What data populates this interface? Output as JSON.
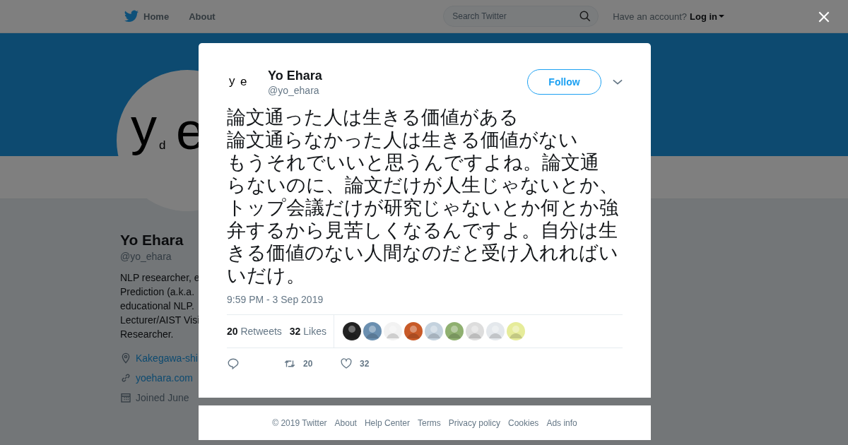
{
  "topbar": {
    "nav": [
      {
        "label": "Home",
        "kind": "home"
      },
      {
        "label": "About",
        "kind": "plain"
      }
    ],
    "search": {
      "placeholder": "Search Twitter"
    },
    "account_prompt": "Have an account?",
    "login": "Log in"
  },
  "profile": {
    "avatar_text": [
      "y",
      "d",
      "e"
    ],
    "name": "Yo Ehara",
    "handle": "@yo_ehara",
    "bio_lines": [
      "NLP researcher, e",
      "Prediction (a.k.a.",
      "educational NLP.",
      "Lecturer/AIST Visi",
      "Researcher."
    ],
    "details": [
      {
        "kind": "location",
        "text": "Kakegawa-shi"
      },
      {
        "kind": "link",
        "text": "yoehara.com"
      },
      {
        "kind": "joined",
        "text": "Joined June"
      }
    ]
  },
  "tweet": {
    "avatar_text": [
      "y",
      "e"
    ],
    "name": "Yo Ehara",
    "handle": "@yo_ehara",
    "follow": "Follow",
    "text_lines": [
      "論文通った人は生きる価値がある",
      "論文通らなかった人は生きる価値がない",
      "もうそれでいいと思うんですよね。論文通",
      "らないのに、論文だけが人生じゃないとか、",
      "トップ会議だけが研究じゃないとか何とか強",
      "弁するから見苦しくなるんですよ。自分は生",
      "きる価値のない人間なのだと受け入れればい",
      "いだけ。"
    ],
    "time": "9:59 PM - 3 Sep 2019",
    "stats": [
      {
        "count": "20",
        "label": "Retweets"
      },
      {
        "count": "32",
        "label": "Likes"
      }
    ],
    "likers": [
      {
        "color": "#222222"
      },
      {
        "color": "#6a8fb0"
      },
      {
        "color": "#f2f2f2"
      },
      {
        "color": "#c85a28"
      },
      {
        "color": "#c4d2de"
      },
      {
        "color": "#8fb070"
      },
      {
        "color": "#dddddd"
      },
      {
        "color": "#e4e8ec"
      },
      {
        "color": "#e6ec9a"
      }
    ],
    "actions": [
      {
        "kind": "reply"
      },
      {
        "kind": "retweet",
        "count": "20"
      },
      {
        "kind": "like",
        "count": "32"
      }
    ]
  },
  "footer": [
    "© 2019 Twitter",
    "About",
    "Help Center",
    "Terms",
    "Privacy policy",
    "Cookies",
    "Ads info"
  ]
}
